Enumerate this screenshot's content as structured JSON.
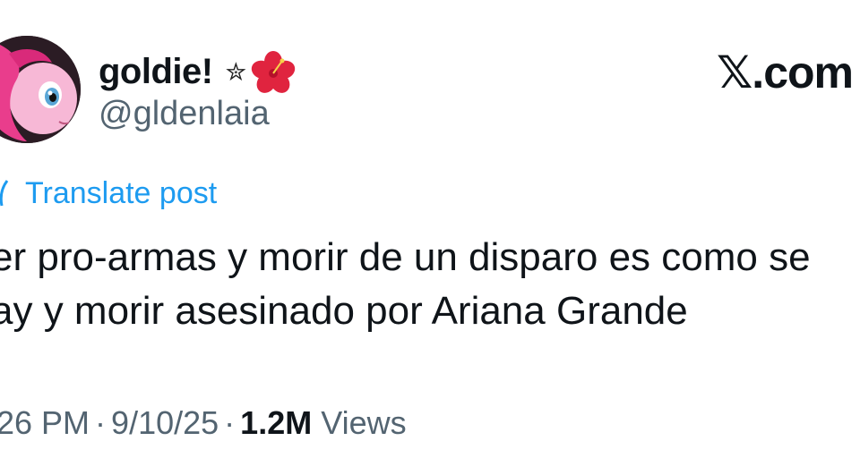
{
  "author": {
    "display_name": "goldie!",
    "star_glyph": "✮",
    "handle": "@gldenlaia",
    "avatar_icon": "pinkie-pie-avatar",
    "flower_icon": "hibiscus-icon"
  },
  "brand": {
    "site_label": ".com",
    "x_glyph": "𝕏"
  },
  "translate": {
    "label": "Translate post",
    "icon": "globe-icon"
  },
  "post": {
    "lines": [
      "er pro-armas y morir de un disparo es como se",
      "ay y morir asesinado por Ariana Grande"
    ]
  },
  "meta": {
    "time": "26 PM",
    "separator": "·",
    "date": "9/10/25",
    "views_count": "1.2M",
    "views_label": "Views"
  },
  "colors": {
    "text": "#0f1419",
    "secondary": "#536471",
    "link": "#1d9bf0"
  }
}
